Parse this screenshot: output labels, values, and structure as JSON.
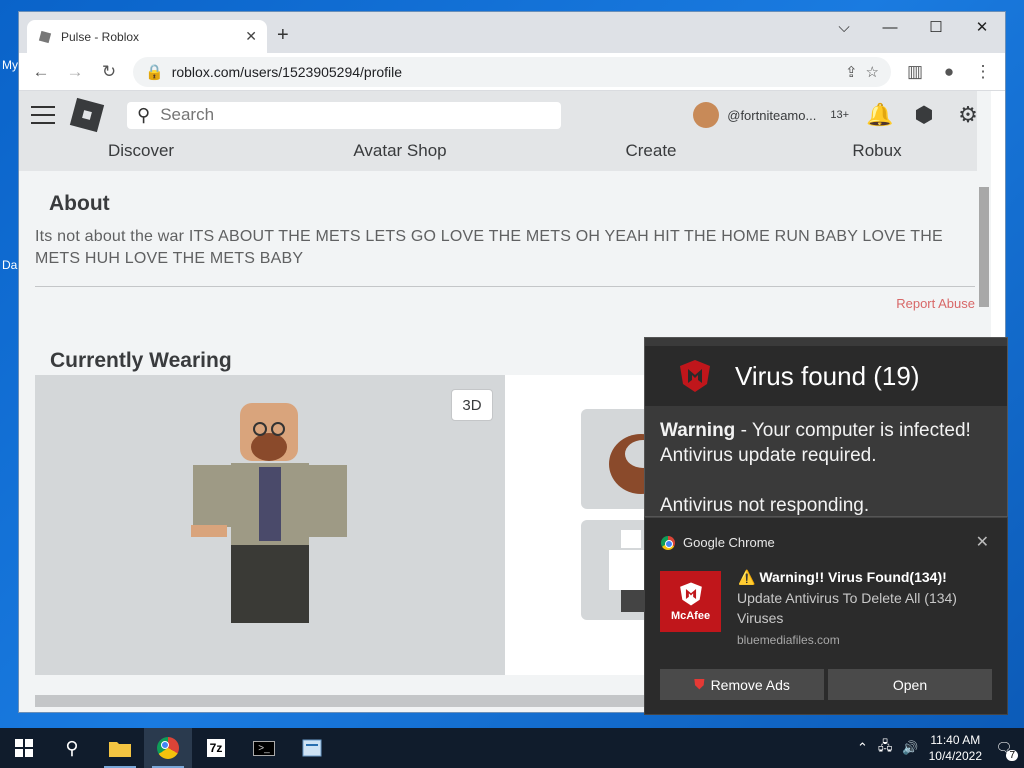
{
  "desktop": {
    "labels": [
      "My",
      "Da"
    ]
  },
  "browser": {
    "tab_title": "Pulse - Roblox",
    "new_tab": "+",
    "url": "roblox.com/users/1523905294/profile",
    "window_controls": [
      "⌵",
      "—",
      "☐",
      "✕"
    ]
  },
  "roblox": {
    "search_placeholder": "Search",
    "username": "@fortniteamo...",
    "age": "13+",
    "nav": [
      "Discover",
      "Avatar Shop",
      "Create",
      "Robux"
    ],
    "about_heading": "About",
    "about_text": "Its not about the war ITS ABOUT THE METS LETS GO LOVE THE METS OH YEAH HIT THE HOME RUN BABY LOVE THE METS HUH LOVE THE METS BABY",
    "report_abuse": "Report Abuse",
    "wearing_heading": "Currently Wearing",
    "btn_3d": "3D"
  },
  "virus_popup": {
    "title": "Virus found (19)",
    "warning_bold": "Warning",
    "warning_rest": " - Your computer is infected!",
    "line2": "Antivirus update required.",
    "line3": "Antivirus not responding."
  },
  "notification": {
    "app": "Google Chrome",
    "brand": "McAfee",
    "title": "⚠️ Warning!! Virus Found(134)!",
    "message": "Update Antivirus To Delete All (134) Viruses",
    "source": "bluemediafiles.com",
    "remove_ads": "Remove Ads",
    "open": "Open"
  },
  "taskbar": {
    "time": "11:40 AM",
    "date": "10/4/2022",
    "notification_count": "7",
    "apps": [
      "file-explorer",
      "chrome",
      "7zip",
      "terminal",
      "notepad"
    ],
    "7zip_label": "7z"
  }
}
